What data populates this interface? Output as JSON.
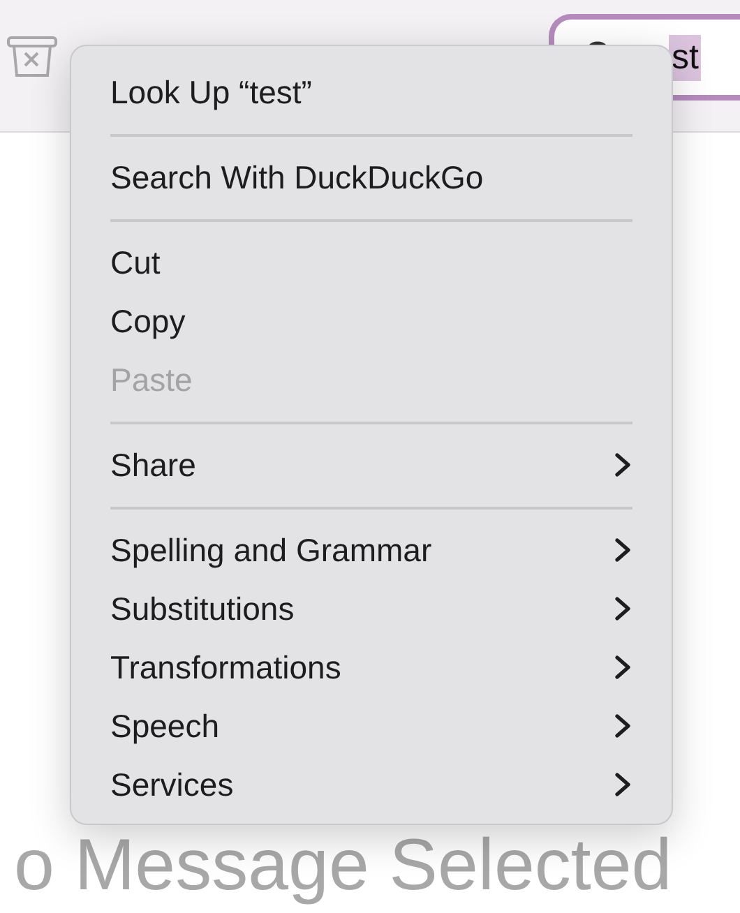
{
  "toolbar": {
    "search": {
      "value": "st",
      "text_selected": true
    }
  },
  "empty_state": "o Message Selected",
  "context_menu": [
    {
      "kind": "item",
      "label": "Look Up “test”",
      "disabled": false,
      "submenu": false
    },
    {
      "kind": "separator"
    },
    {
      "kind": "item",
      "label": "Search With DuckDuckGo",
      "disabled": false,
      "submenu": false
    },
    {
      "kind": "separator"
    },
    {
      "kind": "item",
      "label": "Cut",
      "disabled": false,
      "submenu": false
    },
    {
      "kind": "item",
      "label": "Copy",
      "disabled": false,
      "submenu": false
    },
    {
      "kind": "item",
      "label": "Paste",
      "disabled": true,
      "submenu": false
    },
    {
      "kind": "separator"
    },
    {
      "kind": "item",
      "label": "Share",
      "disabled": false,
      "submenu": true
    },
    {
      "kind": "separator"
    },
    {
      "kind": "item",
      "label": "Spelling and Grammar",
      "disabled": false,
      "submenu": true
    },
    {
      "kind": "item",
      "label": "Substitutions",
      "disabled": false,
      "submenu": true
    },
    {
      "kind": "item",
      "label": "Transformations",
      "disabled": false,
      "submenu": true
    },
    {
      "kind": "item",
      "label": "Speech",
      "disabled": false,
      "submenu": true
    },
    {
      "kind": "item",
      "label": "Services",
      "disabled": false,
      "submenu": true
    }
  ]
}
